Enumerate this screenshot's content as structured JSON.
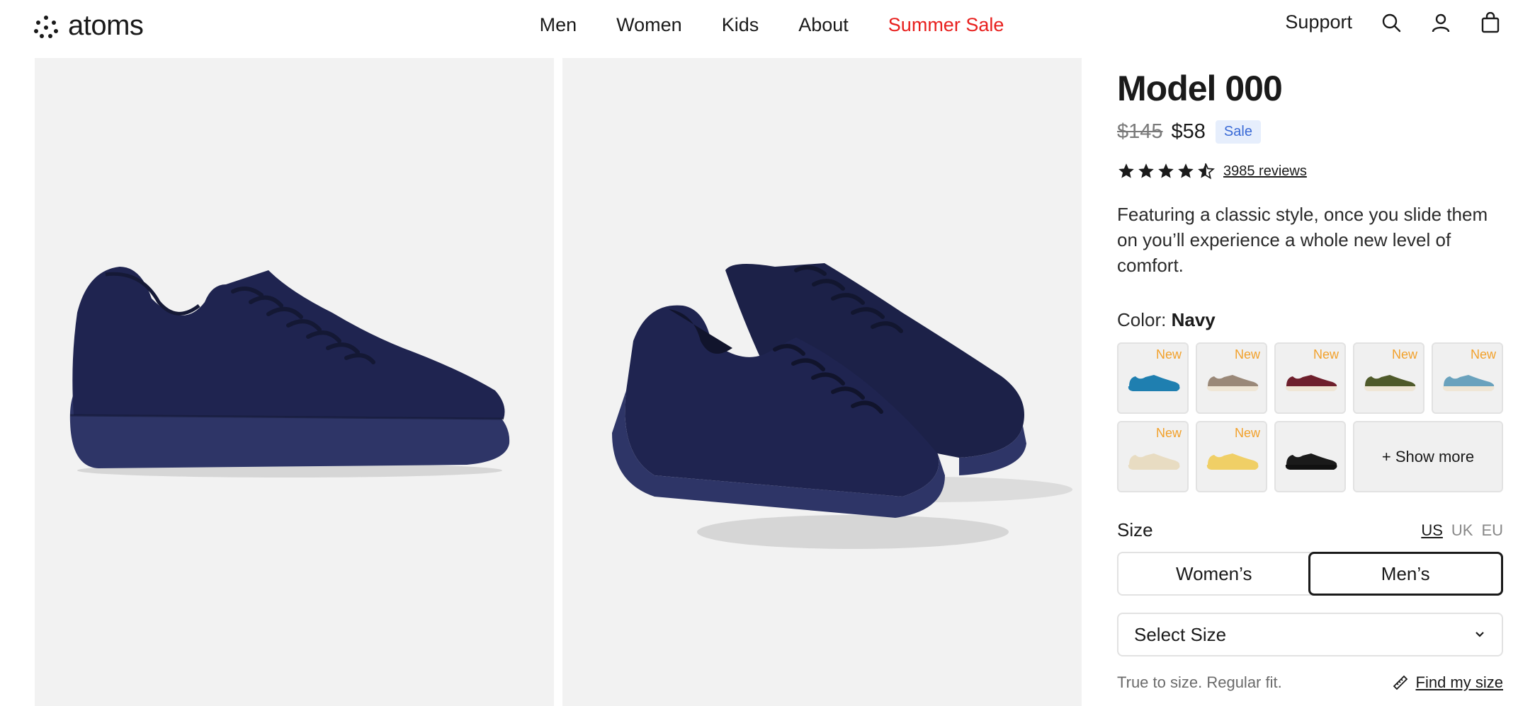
{
  "brand": {
    "name": "atoms"
  },
  "nav": {
    "items": [
      {
        "label": "Men"
      },
      {
        "label": "Women"
      },
      {
        "label": "Kids"
      },
      {
        "label": "About"
      },
      {
        "label": "Summer Sale"
      }
    ],
    "sale_color": "#e8201e"
  },
  "header": {
    "support_label": "Support",
    "icons": [
      "search-icon",
      "account-icon",
      "bag-icon"
    ]
  },
  "product": {
    "title": "Model 000",
    "price_original": "$145",
    "price_sale": "$58",
    "badge": "Sale",
    "rating": 4.5,
    "reviews_label": "3985 reviews",
    "description": "Featuring a classic style, once you slide them on you’ll experience a whole new level of comfort.",
    "color_prefix": "Color:",
    "color_selected": "Navy",
    "product_color": "#1f2450"
  },
  "swatches": [
    {
      "name": "blue",
      "color": "#1f7fb0",
      "new_label": "New"
    },
    {
      "name": "taupe",
      "color": "#9a8878",
      "new_label": "New"
    },
    {
      "name": "burgundy",
      "color": "#6e1f2c",
      "new_label": "New"
    },
    {
      "name": "olive",
      "color": "#4f5a2a",
      "new_label": "New"
    },
    {
      "name": "sky",
      "color": "#6aa2bd",
      "new_label": "New"
    },
    {
      "name": "cream",
      "color": "#e8dcc2",
      "new_label": "New"
    },
    {
      "name": "yellow",
      "color": "#f0cf66",
      "new_label": "New"
    },
    {
      "name": "black",
      "color": "#1a1a1a",
      "new_label": ""
    }
  ],
  "show_more_label": "+ Show more",
  "size": {
    "label": "Size",
    "units": [
      "US",
      "UK",
      "EU"
    ],
    "active_unit": "US",
    "gender_options": [
      "Women’s",
      "Men’s"
    ],
    "active_gender": "Men’s",
    "select_placeholder": "Select Size",
    "fit_note": "True to size. Regular fit.",
    "find_size_label": "Find my size"
  }
}
